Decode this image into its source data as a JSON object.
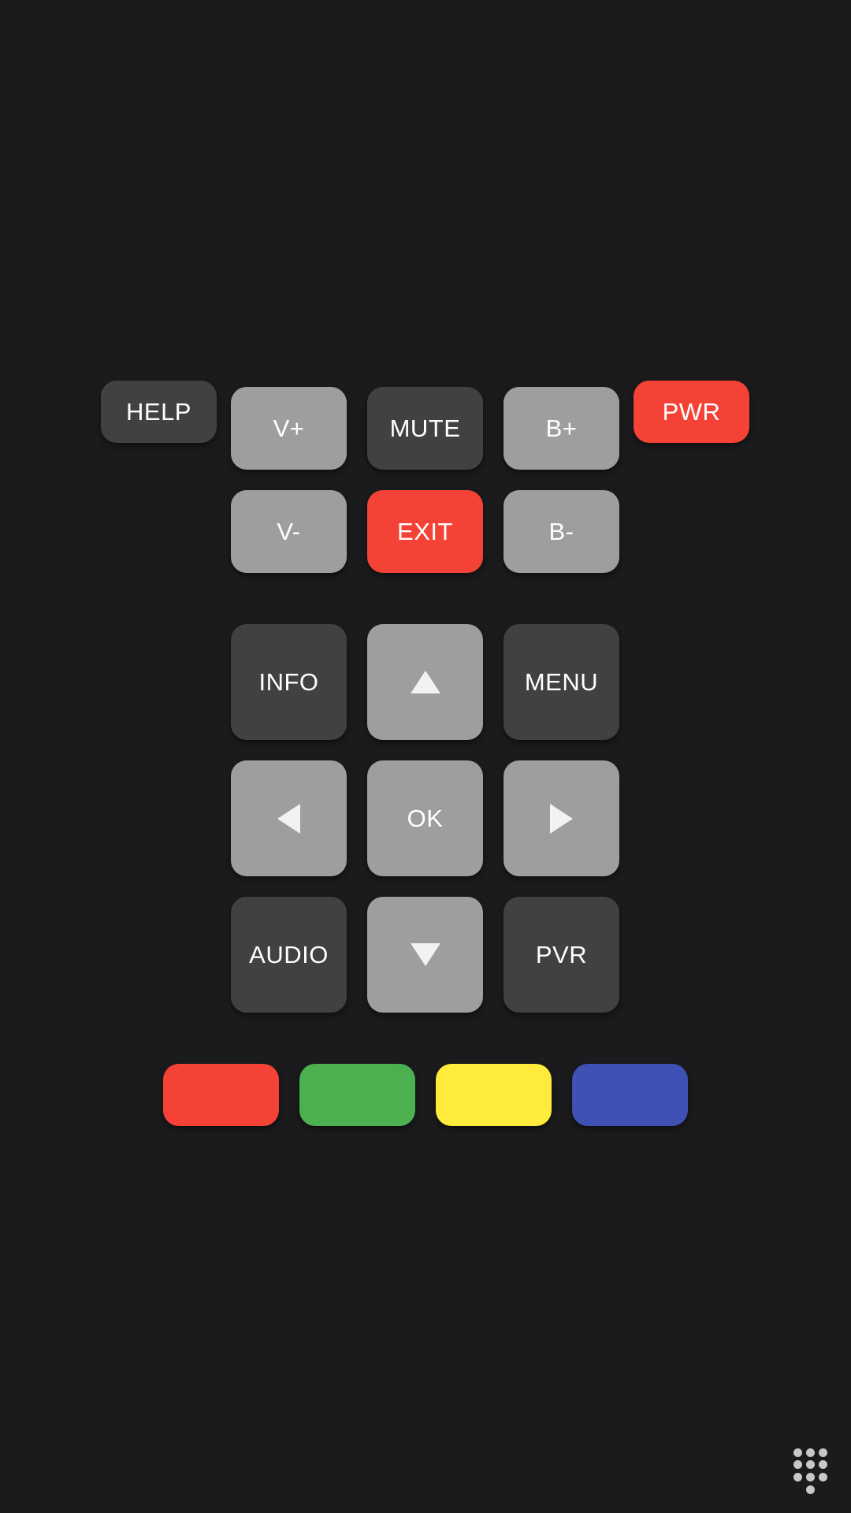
{
  "buttons": {
    "help": "HELP",
    "vol_up": "V+",
    "mute": "MUTE",
    "bright_up": "B+",
    "power": "PWR",
    "vol_down": "V-",
    "exit": "EXIT",
    "bright_down": "B-",
    "info": "INFO",
    "menu": "MENU",
    "ok": "OK",
    "audio": "AUDIO",
    "pvr": "PVR"
  },
  "icons": {
    "up": "arrow-up-icon",
    "down": "arrow-down-icon",
    "left": "arrow-left-icon",
    "right": "arrow-right-icon",
    "keypad": "keypad-icon"
  },
  "colors": {
    "background": "#1b1b1d",
    "light_button": "#9e9e9e",
    "dark_button": "#414141",
    "red": "#f44336",
    "green": "#4caf50",
    "yellow": "#ffeb3b",
    "blue": "#3f51b5"
  }
}
